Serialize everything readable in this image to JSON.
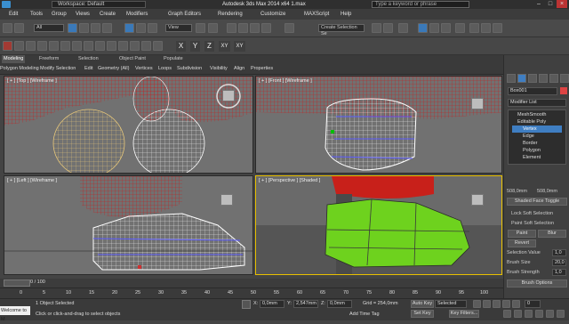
{
  "titlebar": {
    "workspace": "Workspace: Default",
    "title": "Autodesk 3ds Max  2014 x64      1.max",
    "search_placeholder": "Type a keyword or phrase"
  },
  "menu": [
    "Edit",
    "Tools",
    "Group",
    "Views",
    "Create",
    "Modifiers",
    "Graph Editors",
    "Rendering",
    "Customize",
    "MAXScript",
    "Help"
  ],
  "toolbar": {
    "selection_filter": "All",
    "ref_coord": "View",
    "named_selection": "Create Selection Se"
  },
  "toolbar2": {
    "axis_x": "X",
    "axis_y": "Y",
    "axis_z": "Z",
    "axis_xy": "XY",
    "axis_xy2": "XY"
  },
  "ribbon": {
    "tabs": [
      "Modeling",
      "Freeform",
      "Selection",
      "Object Paint",
      "Populate"
    ],
    "sub": [
      "Polygon Modeling",
      "Modify Selection",
      "Edit",
      "Geometry (All)",
      "Vertices",
      "Loops",
      "Subdivision",
      "Visibility",
      "Align",
      "Properties"
    ]
  },
  "viewports": {
    "top": "[ + ] [Top ] [Wireframe ]",
    "front": "[ + ] [Front ] [Wireframe ]",
    "left": "[ + ] [Left ] [Wireframe ]",
    "perspective": "[ + ] [Perspective ] [Shaded ]"
  },
  "command_panel": {
    "object_name": "Box001",
    "modifier_list": "Modifier List",
    "stack": [
      "MeshSmooth",
      "Editable Poly",
      "Vertex",
      "Edge",
      "Border",
      "Polygon",
      "Element"
    ],
    "selected_stack_item": "Vertex",
    "value1": "508,0mm",
    "value2": "508,0mm",
    "shaded_face_toggle": "Shaded Face Toggle",
    "lock_soft": "Lock Soft Selection",
    "paint_soft": "Paint Soft Selection",
    "paint": "Paint",
    "blur": "Blur",
    "revert": "Revert",
    "selection_value": "Selection Value",
    "sel_value": "1,0",
    "brush_size": "Brush Size",
    "brush_size_value": "20,0",
    "brush_strength": "Brush Strength",
    "brush_strength_value": "1,0",
    "brush_options": "Brush Options"
  },
  "timeline": {
    "frame_counter": "0 / 100",
    "ticks": [
      "0",
      "5",
      "10",
      "15",
      "20",
      "25",
      "30",
      "35",
      "40",
      "45",
      "50",
      "55",
      "60",
      "65",
      "70",
      "75",
      "80",
      "85",
      "90",
      "95",
      "100"
    ]
  },
  "status": {
    "maxscript": "Welcome to M",
    "selected_count": "1 Object Selected",
    "prompt": "Click or click-and-drag to select objects",
    "x_label": "X:",
    "x_value": "0,0mm",
    "y_label": "Y:",
    "y_value": "2,547mm",
    "z_label": "Z:",
    "z_value": "0,0mm",
    "grid": "Grid = 254,0mm",
    "add_time_tag": "Add Time Tag",
    "auto_key": "Auto Key",
    "set_key": "Set Key",
    "key_mode": "Selected",
    "key_filters": "Key Filters...",
    "frame": "0"
  }
}
